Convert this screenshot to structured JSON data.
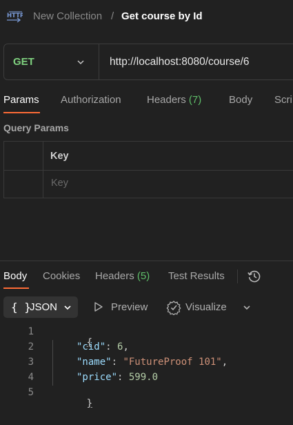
{
  "header": {
    "collection": "New Collection",
    "separator": "/",
    "title": "Get course by Id"
  },
  "request": {
    "method": "GET",
    "url": "http://localhost:8080/course/6"
  },
  "request_tabs": [
    {
      "label": "Params"
    },
    {
      "label": "Authorization"
    },
    {
      "label": "Headers",
      "count": "(7)"
    },
    {
      "label": "Body"
    },
    {
      "label": "Scri"
    }
  ],
  "query_params": {
    "title": "Query Params",
    "key_header": "Key",
    "key_placeholder": "Key"
  },
  "response_tabs": [
    {
      "label": "Body"
    },
    {
      "label": "Cookies"
    },
    {
      "label": "Headers",
      "count": "(5)"
    },
    {
      "label": "Test Results"
    }
  ],
  "response_toolbar": {
    "format_icon": "{ }",
    "format": "JSON",
    "preview": "Preview",
    "visualize": "Visualize"
  },
  "response_body": {
    "line_numbers": [
      "1",
      "2",
      "3",
      "4",
      "5"
    ],
    "open_brace": "{",
    "close_brace": "}",
    "fields": [
      {
        "key": "\"cid\"",
        "value": "6",
        "type": "number",
        "trail": ","
      },
      {
        "key": "\"name\"",
        "value": "\"FutureProof 101\"",
        "type": "string",
        "trail": ","
      },
      {
        "key": "\"price\"",
        "value": "599.0",
        "type": "number",
        "trail": ""
      }
    ]
  },
  "icons": {
    "http": "http-icon",
    "history": "history-icon",
    "preview": "play-icon",
    "visualize": "visualize-icon"
  },
  "colors": {
    "background": "#212121",
    "accent": "#ff6c37",
    "method_get": "#7fd17f",
    "count_green": "#5fbf6a"
  }
}
